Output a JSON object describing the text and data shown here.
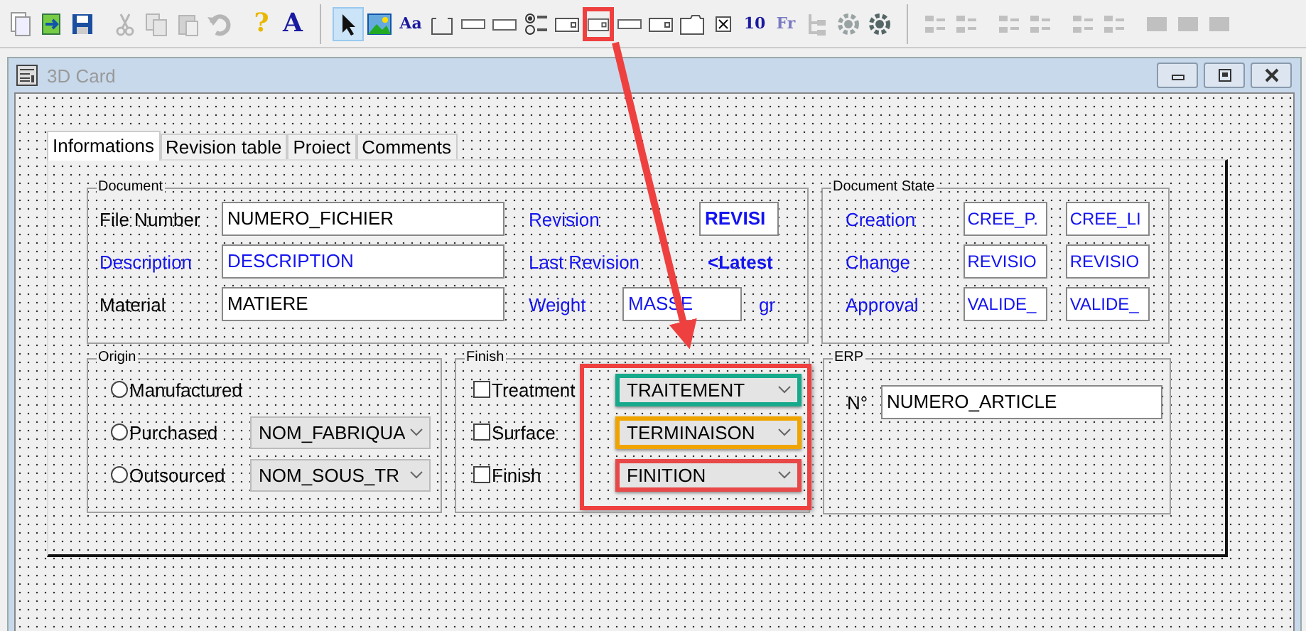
{
  "toolbar": [
    {
      "kind": "new",
      "disabled": false,
      "selected": false,
      "highlighted": false
    },
    {
      "kind": "sync",
      "disabled": false,
      "selected": false,
      "highlighted": false
    },
    {
      "kind": "save",
      "disabled": false,
      "selected": false,
      "highlighted": false
    },
    {
      "kind": "separator"
    },
    {
      "kind": "cut",
      "disabled": true,
      "selected": false,
      "highlighted": false
    },
    {
      "kind": "copy",
      "disabled": true,
      "selected": false,
      "highlighted": false
    },
    {
      "kind": "paste",
      "disabled": true,
      "selected": false,
      "highlighted": false
    },
    {
      "kind": "undo",
      "disabled": true,
      "selected": false,
      "highlighted": false
    },
    {
      "kind": "separator"
    },
    {
      "kind": "glyph",
      "glyph": "?",
      "disabled": false,
      "selected": false,
      "highlighted": false
    },
    {
      "kind": "glyph",
      "glyph": "A",
      "disabled": false,
      "selected": false,
      "highlighted": false
    },
    {
      "kind": "divider"
    },
    {
      "kind": "pointer",
      "disabled": false,
      "selected": true,
      "highlighted": false
    },
    {
      "kind": "image",
      "disabled": false,
      "selected": false,
      "highlighted": false
    },
    {
      "kind": "glyph",
      "glyph": "Aa",
      "disabled": false,
      "selected": false,
      "highlighted": false
    },
    {
      "kind": "frame",
      "disabled": false,
      "selected": false,
      "highlighted": false
    },
    {
      "kind": "line",
      "disabled": false,
      "selected": false,
      "highlighted": false
    },
    {
      "kind": "field",
      "disabled": false,
      "selected": false,
      "highlighted": false
    },
    {
      "kind": "radio",
      "disabled": false,
      "selected": false,
      "highlighted": false
    },
    {
      "kind": "combo",
      "disabled": false,
      "selected": false,
      "highlighted": false
    },
    {
      "kind": "combo",
      "disabled": false,
      "selected": false,
      "highlighted": true
    },
    {
      "kind": "line",
      "disabled": false,
      "selected": false,
      "highlighted": false
    },
    {
      "kind": "combo",
      "disabled": false,
      "selected": false,
      "highlighted": false
    },
    {
      "kind": "tab",
      "disabled": false,
      "selected": false,
      "highlighted": false
    },
    {
      "kind": "check",
      "disabled": false,
      "selected": false,
      "highlighted": false
    },
    {
      "kind": "glyph",
      "glyph": "10",
      "disabled": false,
      "selected": false,
      "highlighted": false
    },
    {
      "kind": "glyph",
      "glyph": "Fr",
      "disabled": true,
      "selected": false,
      "highlighted": false
    },
    {
      "kind": "tree",
      "disabled": true,
      "selected": false,
      "highlighted": false
    },
    {
      "kind": "gear",
      "disabled": true,
      "selected": false,
      "highlighted": false
    },
    {
      "kind": "gear",
      "disabled": false,
      "selected": false,
      "highlighted": false
    },
    {
      "kind": "divider"
    },
    {
      "kind": "align",
      "disabled": true,
      "selected": false,
      "highlighted": false
    },
    {
      "kind": "align",
      "disabled": true,
      "selected": false,
      "highlighted": false
    },
    {
      "kind": "separator"
    },
    {
      "kind": "align",
      "disabled": true,
      "selected": false,
      "highlighted": false
    },
    {
      "kind": "align",
      "disabled": true,
      "selected": false,
      "highlighted": false
    },
    {
      "kind": "separator"
    },
    {
      "kind": "align",
      "disabled": true,
      "selected": false,
      "highlighted": false
    },
    {
      "kind": "align",
      "disabled": true,
      "selected": false,
      "highlighted": false
    },
    {
      "kind": "separator"
    },
    {
      "kind": "size",
      "disabled": true,
      "selected": false,
      "highlighted": false
    },
    {
      "kind": "size",
      "disabled": true,
      "selected": false,
      "highlighted": false
    },
    {
      "kind": "size",
      "disabled": true,
      "selected": false,
      "highlighted": false
    }
  ],
  "window": {
    "title": "3D Card"
  },
  "tabs": [
    {
      "label": "Informations",
      "selected": true
    },
    {
      "label": "Revision table",
      "selected": false
    },
    {
      "label": "Proiect",
      "selected": false
    },
    {
      "label": "Comments",
      "selected": false
    }
  ],
  "document": {
    "title": "Document",
    "fields": [
      {
        "label": "File Number",
        "value": "NUMERO_FICHIER",
        "linked": false
      },
      {
        "label": "Description",
        "value": "DESCRIPTION",
        "linked": true
      },
      {
        "label": "Material",
        "value": "MATIERE",
        "linked": false
      }
    ],
    "revision_fields": [
      {
        "label": "Revision",
        "value": "REVISI",
        "kind": "box",
        "linked": true
      },
      {
        "label": "Last Revision",
        "value": "<Latest",
        "kind": "text",
        "linked": true
      },
      {
        "label": "Weight",
        "value": "MASSE",
        "kind": "box",
        "unit": "gr",
        "linked": true
      }
    ]
  },
  "document_state": {
    "title": "Document State",
    "rows": [
      {
        "label": "Creation",
        "values": [
          "CREE_P.",
          "CREE_LI"
        ]
      },
      {
        "label": "Change",
        "values": [
          "REVISIO",
          "REVISIO"
        ]
      },
      {
        "label": "Approval",
        "values": [
          "VALIDE_",
          "VALIDE_"
        ]
      }
    ]
  },
  "origin": {
    "title": "Origin",
    "options": [
      {
        "label": "Manufactured",
        "selected": false
      },
      {
        "label": "Purchased",
        "selected": false,
        "combo": "NOM_FABRIQUA"
      },
      {
        "label": "Outsourced",
        "selected": false,
        "combo": "NOM_SOUS_TR"
      }
    ]
  },
  "finish": {
    "title": "Finish",
    "options": [
      {
        "label": "Treatment",
        "checked": false,
        "combo": "TRAITEMENT",
        "color": "#17a98b"
      },
      {
        "label": "Surface",
        "checked": false,
        "combo": "TERMINAISON",
        "color": "#f0a400"
      },
      {
        "label": "Finish",
        "checked": false,
        "combo": "FINITION",
        "color": "#e84848"
      }
    ]
  },
  "erp": {
    "title": "ERP",
    "label": "N°",
    "value": "NUMERO_ARTICLE"
  }
}
